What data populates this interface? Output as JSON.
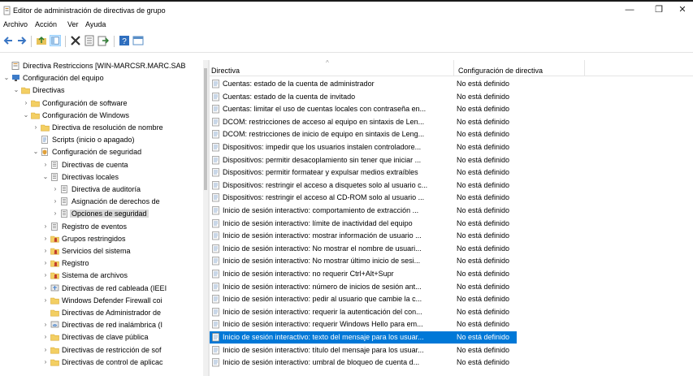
{
  "window": {
    "title": "Editor de administración de directivas de grupo",
    "min_glyph": "—",
    "max_glyph": "❐",
    "close_glyph": "✕"
  },
  "menu": [
    "Archivo",
    "Acción",
    "Ver",
    "Ayuda"
  ],
  "toolbar": [
    "back-icon",
    "forward-icon",
    "up-folder-icon",
    "show-hide-tree-icon",
    "delete-icon",
    "properties-icon",
    "export-list-icon",
    "help-icon",
    "view-icon"
  ],
  "tree": [
    {
      "label": "Directiva Restriccions [WIN-MARCSR.MARC.SAB",
      "indent": 0,
      "expander": "",
      "icon": "policy-icon"
    },
    {
      "label": "Configuración del equipo",
      "indent": 0,
      "expander": "v",
      "icon": "computer-icon"
    },
    {
      "label": "Directivas",
      "indent": 1,
      "expander": "v",
      "icon": "folder-icon"
    },
    {
      "label": "Configuración de software",
      "indent": 2,
      "expander": ">",
      "icon": "folder-icon"
    },
    {
      "label": "Configuración de Windows",
      "indent": 2,
      "expander": "v",
      "icon": "folder-icon"
    },
    {
      "label": "Directiva de resolución de nombre",
      "indent": 3,
      "expander": ">",
      "icon": "folder-icon"
    },
    {
      "label": "Scripts (inicio o apagado)",
      "indent": 3,
      "expander": "",
      "icon": "script-icon"
    },
    {
      "label": "Configuración de seguridad",
      "indent": 3,
      "expander": "v",
      "icon": "security-icon"
    },
    {
      "label": "Directivas de cuenta",
      "indent": 4,
      "expander": ">",
      "icon": "folder-doc-icon"
    },
    {
      "label": "Directivas locales",
      "indent": 4,
      "expander": "v",
      "icon": "folder-doc-icon"
    },
    {
      "label": "Directiva de auditoría",
      "indent": 5,
      "expander": ">",
      "icon": "folder-doc-icon"
    },
    {
      "label": "Asignación de derechos de",
      "indent": 5,
      "expander": ">",
      "icon": "folder-doc-icon"
    },
    {
      "label": "Opciones de seguridad",
      "indent": 5,
      "expander": ">",
      "icon": "folder-doc-icon",
      "selected": true
    },
    {
      "label": "Registro de eventos",
      "indent": 4,
      "expander": ">",
      "icon": "folder-doc-icon"
    },
    {
      "label": "Grupos restringidos",
      "indent": 4,
      "expander": ">",
      "icon": "group-icon"
    },
    {
      "label": "Servicios del sistema",
      "indent": 4,
      "expander": ">",
      "icon": "group-icon"
    },
    {
      "label": "Registro",
      "indent": 4,
      "expander": ">",
      "icon": "group-icon"
    },
    {
      "label": "Sistema de archivos",
      "indent": 4,
      "expander": ">",
      "icon": "group-icon"
    },
    {
      "label": "Directivas de red cableada (IEEI",
      "indent": 4,
      "expander": ">",
      "icon": "network-icon"
    },
    {
      "label": "Windows Defender Firewall coi",
      "indent": 4,
      "expander": ">",
      "icon": "folder-icon"
    },
    {
      "label": "Directivas de Administrador de",
      "indent": 4,
      "expander": "",
      "icon": "folder-icon"
    },
    {
      "label": "Directivas de red inalámbrica (I",
      "indent": 4,
      "expander": ">",
      "icon": "wireless-icon"
    },
    {
      "label": "Directivas de clave pública",
      "indent": 4,
      "expander": ">",
      "icon": "folder-icon"
    },
    {
      "label": "Directivas de restricción de sof",
      "indent": 4,
      "expander": ">",
      "icon": "folder-icon"
    },
    {
      "label": "Directivas de control de aplicac",
      "indent": 4,
      "expander": ">",
      "icon": "folder-icon"
    }
  ],
  "list": {
    "columns": [
      "Directiva",
      "Configuración de directiva"
    ],
    "rows": [
      {
        "name": "Cuentas: estado de la cuenta de administrador",
        "value": "No está definido"
      },
      {
        "name": "Cuentas: estado de la cuenta de invitado",
        "value": "No está definido"
      },
      {
        "name": "Cuentas: limitar el uso de cuentas locales con contraseña en...",
        "value": "No está definido"
      },
      {
        "name": "DCOM: restricciones de acceso al equipo en sintaxis de Len...",
        "value": "No está definido"
      },
      {
        "name": "DCOM: restricciones de inicio de equipo en sintaxis de Leng...",
        "value": "No está definido"
      },
      {
        "name": "Dispositivos: impedir que los usuarios instalen controladore...",
        "value": "No está definido"
      },
      {
        "name": "Dispositivos: permitir desacoplamiento sin tener que iniciar ...",
        "value": "No está definido"
      },
      {
        "name": "Dispositivos: permitir formatear y expulsar medios extraíbles",
        "value": "No está definido"
      },
      {
        "name": "Dispositivos: restringir el acceso a disquetes solo al usuario c...",
        "value": "No está definido"
      },
      {
        "name": "Dispositivos: restringir el acceso al CD-ROM solo al usuario ...",
        "value": "No está definido"
      },
      {
        "name": "Inicio de sesión interactivo: comportamiento de extracción ...",
        "value": "No está definido"
      },
      {
        "name": "Inicio de sesión interactivo: límite de inactividad del equipo",
        "value": "No está definido"
      },
      {
        "name": "Inicio de sesión interactivo: mostrar información de usuario ...",
        "value": "No está definido"
      },
      {
        "name": "Inicio de sesión interactivo: No mostrar el nombre de usuari...",
        "value": "No está definido"
      },
      {
        "name": "Inicio de sesión interactivo: No mostrar último inicio de sesi...",
        "value": "No está definido"
      },
      {
        "name": "Inicio de sesión interactivo: no requerir Ctrl+Alt+Supr",
        "value": "No está definido"
      },
      {
        "name": "Inicio de sesión interactivo: número de inicios de sesión ant...",
        "value": "No está definido"
      },
      {
        "name": "Inicio de sesión interactivo: pedir al usuario que cambie la c...",
        "value": "No está definido"
      },
      {
        "name": "Inicio de sesión interactivo: requerir la autenticación del con...",
        "value": "No está definido"
      },
      {
        "name": "Inicio de sesión interactivo: requerir Windows Hello para em...",
        "value": "No está definido"
      },
      {
        "name": "Inicio de sesión interactivo: texto del mensaje para los usuar...",
        "value": "No está definido",
        "selected": true
      },
      {
        "name": "Inicio de sesión interactivo: título del mensaje para los usuar...",
        "value": "No está definido"
      },
      {
        "name": "Inicio de sesión interactivo: umbral de bloqueo de cuenta d...",
        "value": "No está definido"
      }
    ]
  }
}
